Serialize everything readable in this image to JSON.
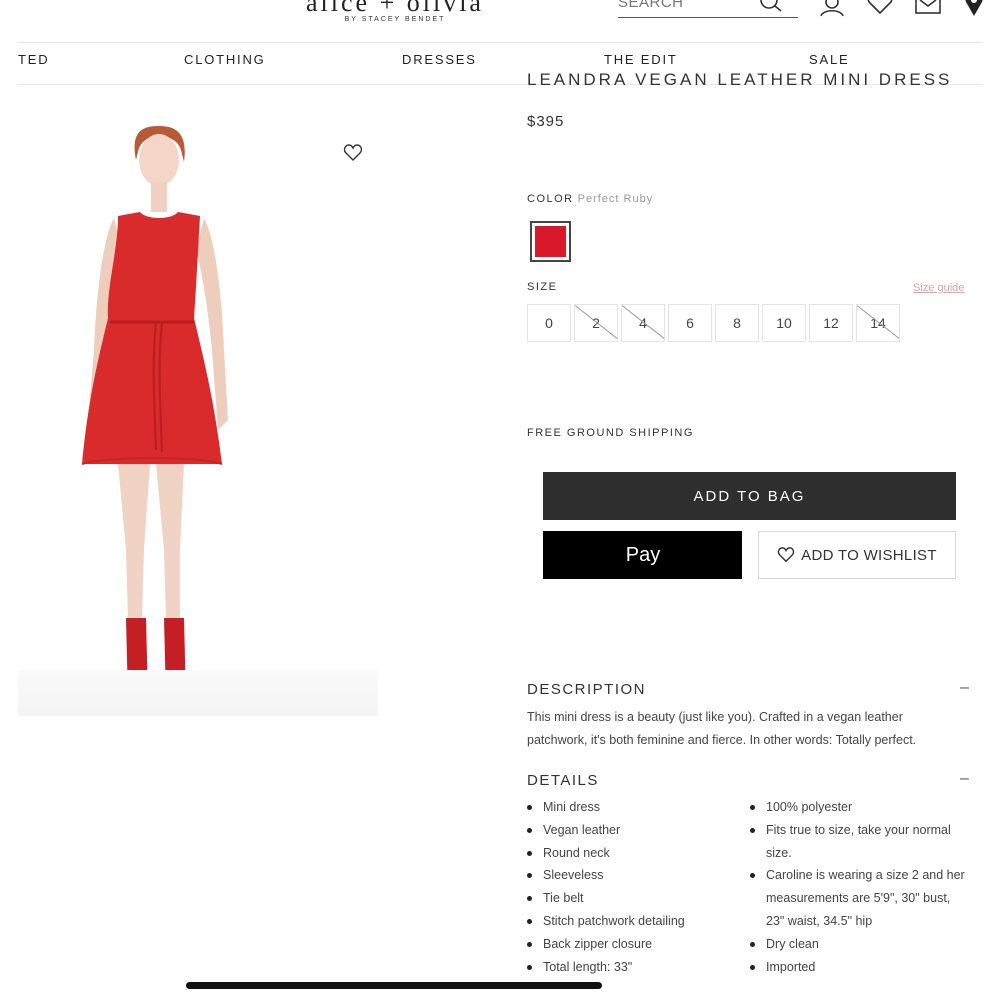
{
  "header": {
    "logo_main": "alice + olivia",
    "logo_sub": "BY STACEY BENDET",
    "search_placeholder": "SEARCH"
  },
  "nav": {
    "items": [
      "TED",
      "CLOTHING",
      "DRESSES",
      "THE EDIT",
      "SALE"
    ]
  },
  "product": {
    "title_clipped": "LEANDRA VEGAN LEATHER MINI DRESS",
    "price": "$395",
    "color_label": "COLOR",
    "color_value": "Perfect Ruby",
    "swatch_color": "#d9182a",
    "size_label": "SIZE",
    "size_guide": "Size guide",
    "sizes": [
      {
        "label": "0",
        "available": true
      },
      {
        "label": "2",
        "available": false
      },
      {
        "label": "4",
        "available": false
      },
      {
        "label": "6",
        "available": true
      },
      {
        "label": "8",
        "available": true
      },
      {
        "label": "10",
        "available": true
      },
      {
        "label": "12",
        "available": true
      },
      {
        "label": "14",
        "available": false
      }
    ],
    "shipping": "FREE GROUND SHIPPING",
    "add_to_bag": "ADD TO BAG",
    "apple_pay": "Pay",
    "add_to_wishlist": "ADD TO WISHLIST"
  },
  "description": {
    "heading": "DESCRIPTION",
    "toggle": "–",
    "line1": "This mini dress is a beauty (just like you). Crafted in a vegan leather",
    "line2": "patchwork, it's both feminine and fierce. In other words: Totally perfect."
  },
  "details": {
    "heading": "DETAILS",
    "toggle": "–",
    "left": [
      "Mini dress",
      "Vegan leather",
      "Round neck",
      "Sleeveless",
      "Tie belt",
      "Stitch patchwork detailing",
      "Back zipper closure",
      "Total length: 33\""
    ],
    "right": [
      "100% polyester",
      "Fits true to size, take your normal size.",
      "Caroline is wearing a size 2 and her measurements are 5'9\", 30\" bust, 23\" waist, 34.5\" hip",
      "Dry clean",
      "Imported"
    ]
  },
  "colors": {
    "accent_dark": "#2e2e2e",
    "ruby": "#d9182a",
    "size_guide": "#d9a3a3"
  },
  "icons": [
    "search-icon",
    "account-icon",
    "heart-icon",
    "bag-icon",
    "location-pin-icon",
    "apple-icon"
  ]
}
